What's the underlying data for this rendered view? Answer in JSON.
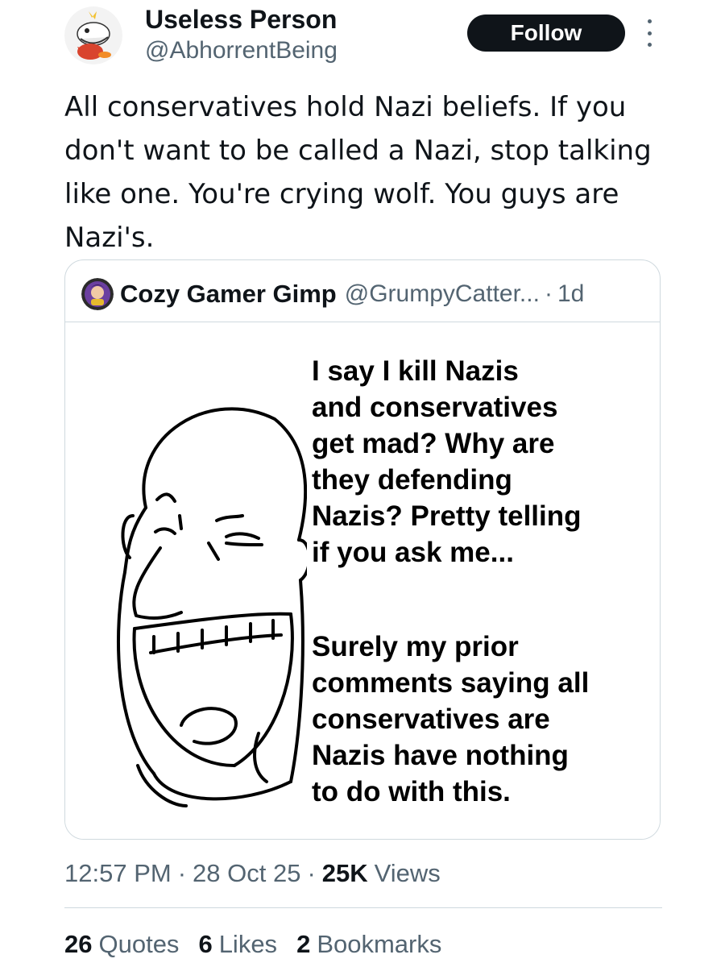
{
  "author": {
    "name": "Useless Person",
    "handle": "@AbhorrentBeing",
    "avatar_icon": "fire-croc-creature-avatar-icon"
  },
  "follow_button": {
    "label": "Follow"
  },
  "more_menu_icon": "more-vertical-icon",
  "tweet": {
    "text": "All conservatives hold Nazi beliefs. If you don't want to be called a Nazi, stop talking like one. You're crying wolf. You guys are Nazi's."
  },
  "quote": {
    "author_name": "Cozy Gamer Gimp",
    "author_handle": "@GrumpyCatter...",
    "separator": "·",
    "time": "1d",
    "avatar_icon": "cartoon-character-avatar-icon",
    "image": {
      "caption_1": "I say I  kill  Nazis\nand conservatives\nget mad? Why are\nthey defending\nNazis? Pretty telling\nif you ask me...",
      "caption_2": "Surely my prior\ncomments saying all\nconservatives are\nNazis have nothing\nto do with this.",
      "figure_icon": "laughing-bald-man-drawing-icon"
    }
  },
  "meta": {
    "time": "12:57 PM",
    "dot": "·",
    "date": "28 Oct 25",
    "views_count": "25K",
    "views_label": "Views"
  },
  "stats": {
    "quotes_count": "26",
    "quotes_label": "Quotes",
    "likes_count": "6",
    "likes_label": "Likes",
    "bookmarks_count": "2",
    "bookmarks_label": "Bookmarks"
  },
  "colors": {
    "text_primary": "#0f1419",
    "text_secondary": "#536471",
    "border": "#cfd9de",
    "follow_bg": "#0f1419"
  }
}
